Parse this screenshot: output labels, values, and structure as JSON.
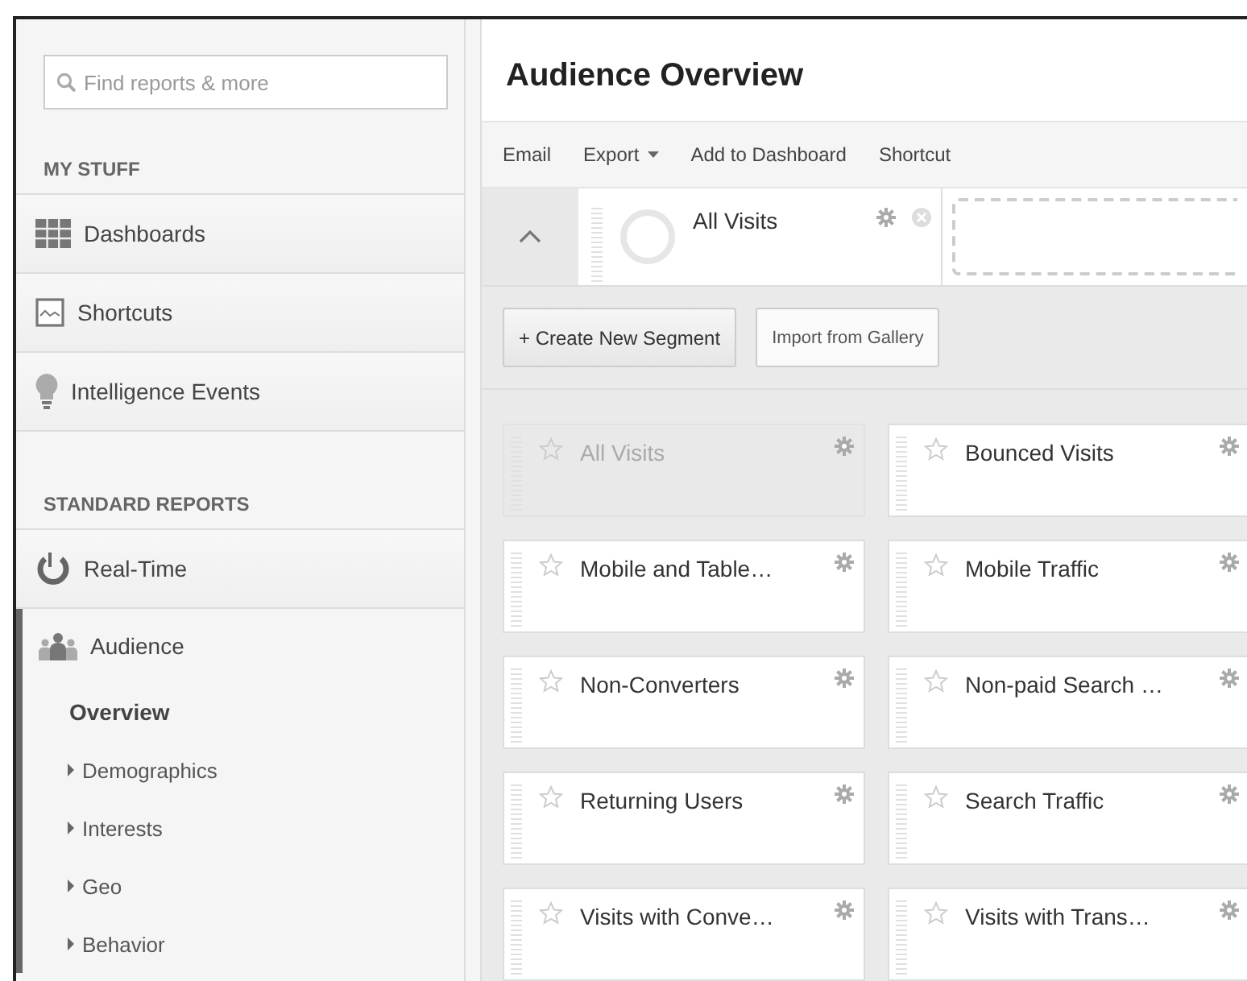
{
  "sidebar": {
    "search": {
      "placeholder": "Find reports & more"
    },
    "sections": [
      {
        "heading": "MY STUFF",
        "items": [
          {
            "label": "Dashboards",
            "selected": false
          },
          {
            "label": "Shortcuts",
            "selected": false
          },
          {
            "label": "Intelligence Events",
            "selected": false
          }
        ]
      },
      {
        "heading": "STANDARD REPORTS",
        "items": [
          {
            "label": "Real-Time",
            "selected": false
          },
          {
            "label": "Audience",
            "selected": true,
            "children": [
              {
                "label": "Overview",
                "selected": true,
                "has_children": false
              },
              {
                "label": "Demographics",
                "selected": false,
                "has_children": true
              },
              {
                "label": "Interests",
                "selected": false,
                "has_children": true
              },
              {
                "label": "Geo",
                "selected": false,
                "has_children": true
              },
              {
                "label": "Behavior",
                "selected": false,
                "has_children": true
              }
            ]
          }
        ]
      }
    ]
  },
  "main": {
    "title": "Audience Overview",
    "toolbar": [
      {
        "label": "Email",
        "dropdown": false
      },
      {
        "label": "Export",
        "dropdown": true
      },
      {
        "label": "Add to Dashboard",
        "dropdown": false
      },
      {
        "label": "Shortcut",
        "dropdown": false
      }
    ],
    "applied_segments": [
      {
        "label": "All Visits"
      }
    ],
    "buttons": [
      {
        "label": "+ Create New Segment",
        "kind": "primary"
      },
      {
        "label": "Import from Gallery",
        "kind": "secondary"
      }
    ],
    "segments": [
      {
        "label": "All Visits",
        "disabled": true
      },
      {
        "label": "Bounced Visits",
        "disabled": false
      },
      {
        "label": "Mobile and Table…",
        "disabled": false
      },
      {
        "label": "Mobile Traffic",
        "disabled": false
      },
      {
        "label": "Non-Converters",
        "disabled": false
      },
      {
        "label": "Non-paid Search …",
        "disabled": false
      },
      {
        "label": "Returning Users",
        "disabled": false
      },
      {
        "label": "Search Traffic",
        "disabled": false
      },
      {
        "label": "Visits with Conve…",
        "disabled": false
      },
      {
        "label": "Visits with Trans…",
        "disabled": false
      }
    ]
  }
}
